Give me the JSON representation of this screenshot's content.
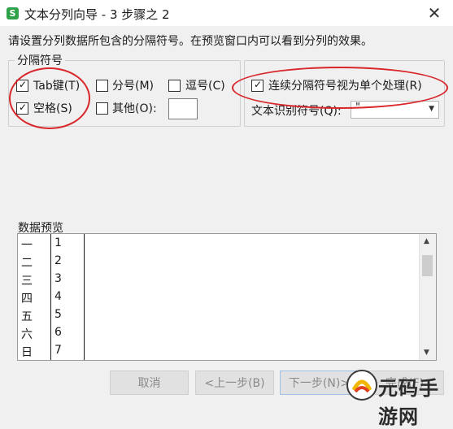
{
  "window": {
    "app_icon_letter": "S",
    "title": "文本分列向导 - 3 步骤之 2",
    "close_glyph": "✕"
  },
  "instruction": "请设置分列数据所包含的分隔符号。在预览窗口内可以看到分列的效果。",
  "delimiters": {
    "legend": "分隔符号",
    "tab": {
      "label": "Tab键(T)",
      "checked": true
    },
    "semicolon": {
      "label": "分号(M)",
      "checked": false
    },
    "comma": {
      "label": "逗号(C)",
      "checked": false
    },
    "space": {
      "label": "空格(S)",
      "checked": true
    },
    "other": {
      "label": "其他(O):",
      "checked": false,
      "value": ""
    }
  },
  "options": {
    "consecutive": {
      "label": "连续分隔符号视为单个处理(R)",
      "checked": true
    },
    "qualifier_label": "文本识别符号(Q):",
    "qualifier_value": "\""
  },
  "preview": {
    "label": "数据预览",
    "rows": [
      [
        "一",
        "1"
      ],
      [
        "二",
        "2"
      ],
      [
        "三",
        "3"
      ],
      [
        "四",
        "4"
      ],
      [
        "五",
        "5"
      ],
      [
        "六",
        "6"
      ],
      [
        "日",
        "7"
      ]
    ]
  },
  "buttons": {
    "cancel": "取消",
    "back": "<上一步(B)",
    "next": "下一步(N)>",
    "finish": "完成(F)"
  },
  "watermark": {
    "text": "元码手游网"
  },
  "colors": {
    "annotation_ring": "#d8262b",
    "app_icon": "#2fa24a"
  }
}
